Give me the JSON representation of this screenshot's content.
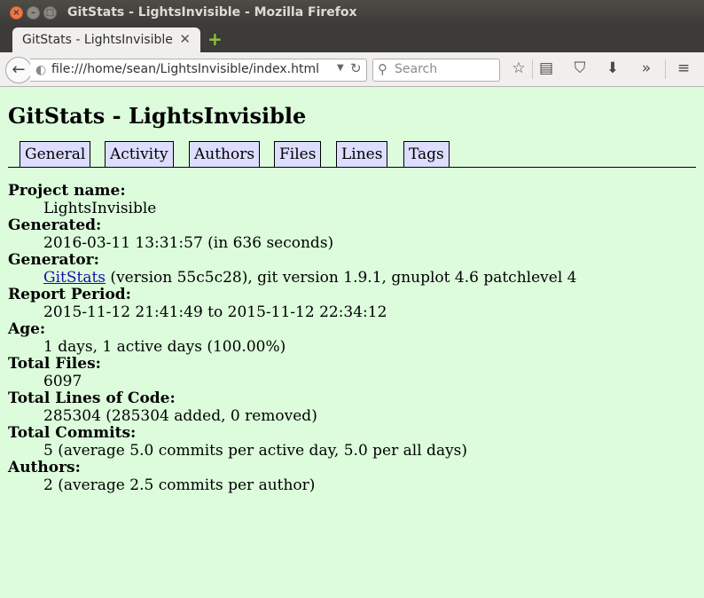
{
  "window": {
    "title": "GitStats - LightsInvisible - Mozilla Firefox",
    "controls": {
      "close": "×",
      "minimize": "–",
      "maximize": "□"
    }
  },
  "tab": {
    "label": "GitStats - LightsInvisible",
    "close": "✕",
    "new_tab": "+"
  },
  "navbar": {
    "url": "file:///home/sean/LightsInvisible/index.html",
    "search_placeholder": "Search"
  },
  "page": {
    "title": "GitStats - LightsInvisible",
    "nav": [
      "General",
      "Activity",
      "Authors",
      "Files",
      "Lines",
      "Tags"
    ],
    "fields": {
      "project_name": {
        "label": "Project name:",
        "value": "LightsInvisible"
      },
      "generated": {
        "label": "Generated:",
        "value": "2016-03-11 13:31:57 (in 636 seconds)"
      },
      "generator": {
        "label": "Generator:",
        "link": "GitStats",
        "value": " (version 55c5c28), git version 1.9.1, gnuplot 4.6 patchlevel 4"
      },
      "report_period": {
        "label": "Report Period:",
        "value": "2015-11-12 21:41:49 to 2015-11-12 22:34:12"
      },
      "age": {
        "label": "Age:",
        "value": "1 days, 1 active days (100.00%)"
      },
      "total_files": {
        "label": "Total Files:",
        "value": "6097"
      },
      "total_loc": {
        "label": "Total Lines of Code:",
        "value": "285304 (285304 added, 0 removed)"
      },
      "total_commits": {
        "label": "Total Commits:",
        "value": "5 (average 5.0 commits per active day, 5.0 per all days)"
      },
      "authors": {
        "label": "Authors:",
        "value": "2 (average 2.5 commits per author)"
      }
    }
  },
  "colors": {
    "page_bg": "#dcfcdc",
    "nav_tab_bg": "#ddddff",
    "link": "#1a0dab"
  }
}
